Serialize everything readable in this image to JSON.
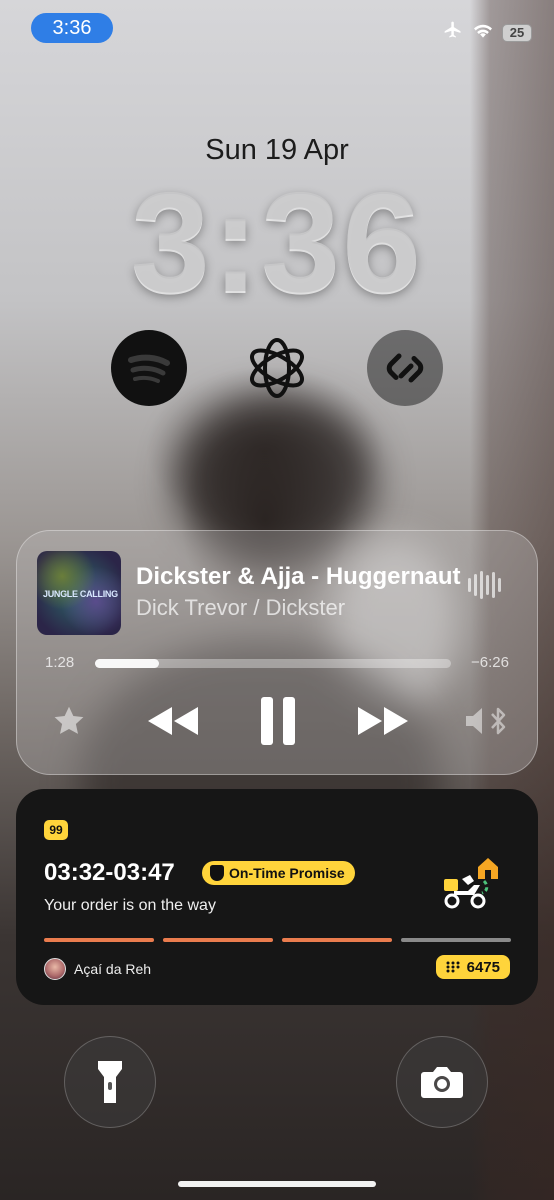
{
  "status_bar": {
    "time": "3:36",
    "battery": "25",
    "icons": [
      "airplane-icon",
      "wifi-icon",
      "battery-icon"
    ]
  },
  "lock_screen": {
    "date": "Sun 19 Apr",
    "clock": "3:36",
    "widgets": [
      "spotify-icon",
      "chatgpt-icon",
      "shazam-icon"
    ]
  },
  "media_player": {
    "album_art_text": "JUNGLE CALLING",
    "title": "Dickster & Ajja - Huggernaut",
    "artist": "Dick Trevor / Dickster",
    "elapsed": "1:28",
    "remaining": "−6:26",
    "progress": 0.18
  },
  "delivery": {
    "app_badge": "99",
    "eta": "03:32-03:47",
    "promise_label": "On-Time Promise",
    "status": "Your order is on the way",
    "progress_steps": [
      {
        "state": "done",
        "color": "#ea7c4e"
      },
      {
        "state": "done",
        "color": "#ea7c4e"
      },
      {
        "state": "done",
        "color": "#ea7c4e"
      },
      {
        "state": "pending",
        "color": "#8a8a8a"
      }
    ],
    "store_name": "Açaí da Reh",
    "code": "6475"
  },
  "colors": {
    "status_pill": "#2f7ee6",
    "brand_yellow": "#ffd43b",
    "progress_orange": "#ea7c4e"
  }
}
